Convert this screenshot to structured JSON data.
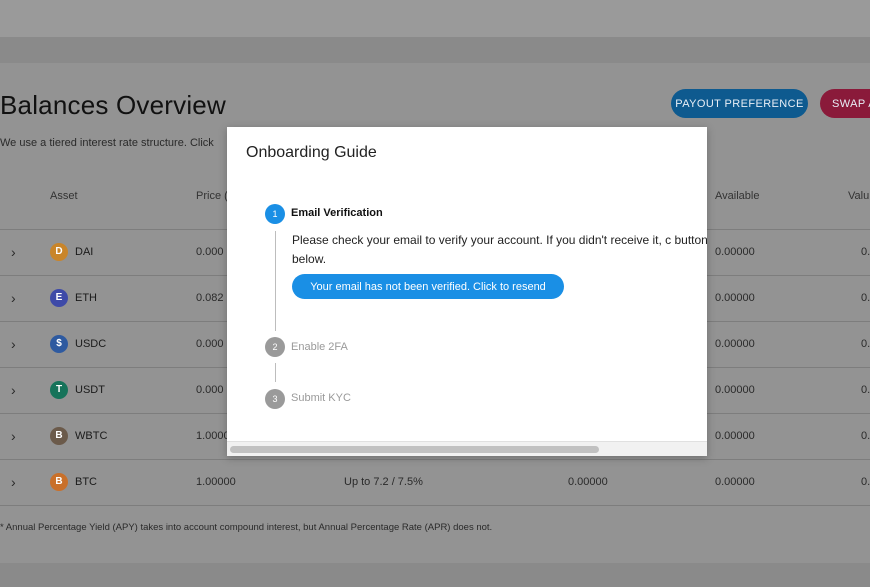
{
  "page": {
    "title": "Balances Overview",
    "subtitle": "We use a tiered interest rate structure. Click",
    "buttons": {
      "payout": "PAYOUT PREFERENCE",
      "swap": "SWAP A"
    }
  },
  "table": {
    "headers": {
      "asset": "Asset",
      "price": "Price (",
      "available": "Available",
      "value": "Valu"
    },
    "rows": [
      {
        "symbol": "DAI",
        "icon": "dai-coin-icon",
        "color": "#c9852a",
        "glyph": "D",
        "price": "0.000",
        "available": "0.00000",
        "value": "0."
      },
      {
        "symbol": "ETH",
        "icon": "eth-coin-icon",
        "color": "#3e4aa8",
        "glyph": "E",
        "price": "0.082",
        "available": "0.00000",
        "value": "0."
      },
      {
        "symbol": "USDC",
        "icon": "usdc-coin-icon",
        "color": "#2e5aa0",
        "glyph": "$",
        "price": "0.000",
        "available": "0.00000",
        "value": "0."
      },
      {
        "symbol": "USDT",
        "icon": "usdt-coin-icon",
        "color": "#16735a",
        "glyph": "T",
        "price": "0.000",
        "available": "0.00000",
        "value": "0."
      },
      {
        "symbol": "WBTC",
        "icon": "wbtc-coin-icon",
        "color": "#6b5a4a",
        "glyph": "B",
        "price": "1.0000",
        "available": "0.00000",
        "value": "0."
      },
      {
        "symbol": "BTC",
        "icon": "btc-coin-icon",
        "color": "#c9702a",
        "glyph": "B",
        "price": "1.00000",
        "rate": "Up to 7.2 / 7.5%",
        "balance": "0.00000",
        "available": "0.00000",
        "value": "0."
      }
    ]
  },
  "footnote": "* Annual Percentage Yield (APY) takes into account compound interest, but Annual Percentage Rate (APR) does not.",
  "modal": {
    "title": "Onboarding Guide",
    "steps": [
      {
        "num": "1",
        "label": "Email Verification"
      },
      {
        "num": "2",
        "label": "Enable 2FA"
      },
      {
        "num": "3",
        "label": "Submit KYC"
      }
    ],
    "step1_text": "Please check your email to verify your account. If you didn't receive it, c button below.",
    "resend_button": "Your email has not been verified. Click to resend"
  },
  "colors": {
    "accent": "#1a8fe5",
    "payout": "#0e5a8f",
    "swap": "#8a1a3a"
  }
}
